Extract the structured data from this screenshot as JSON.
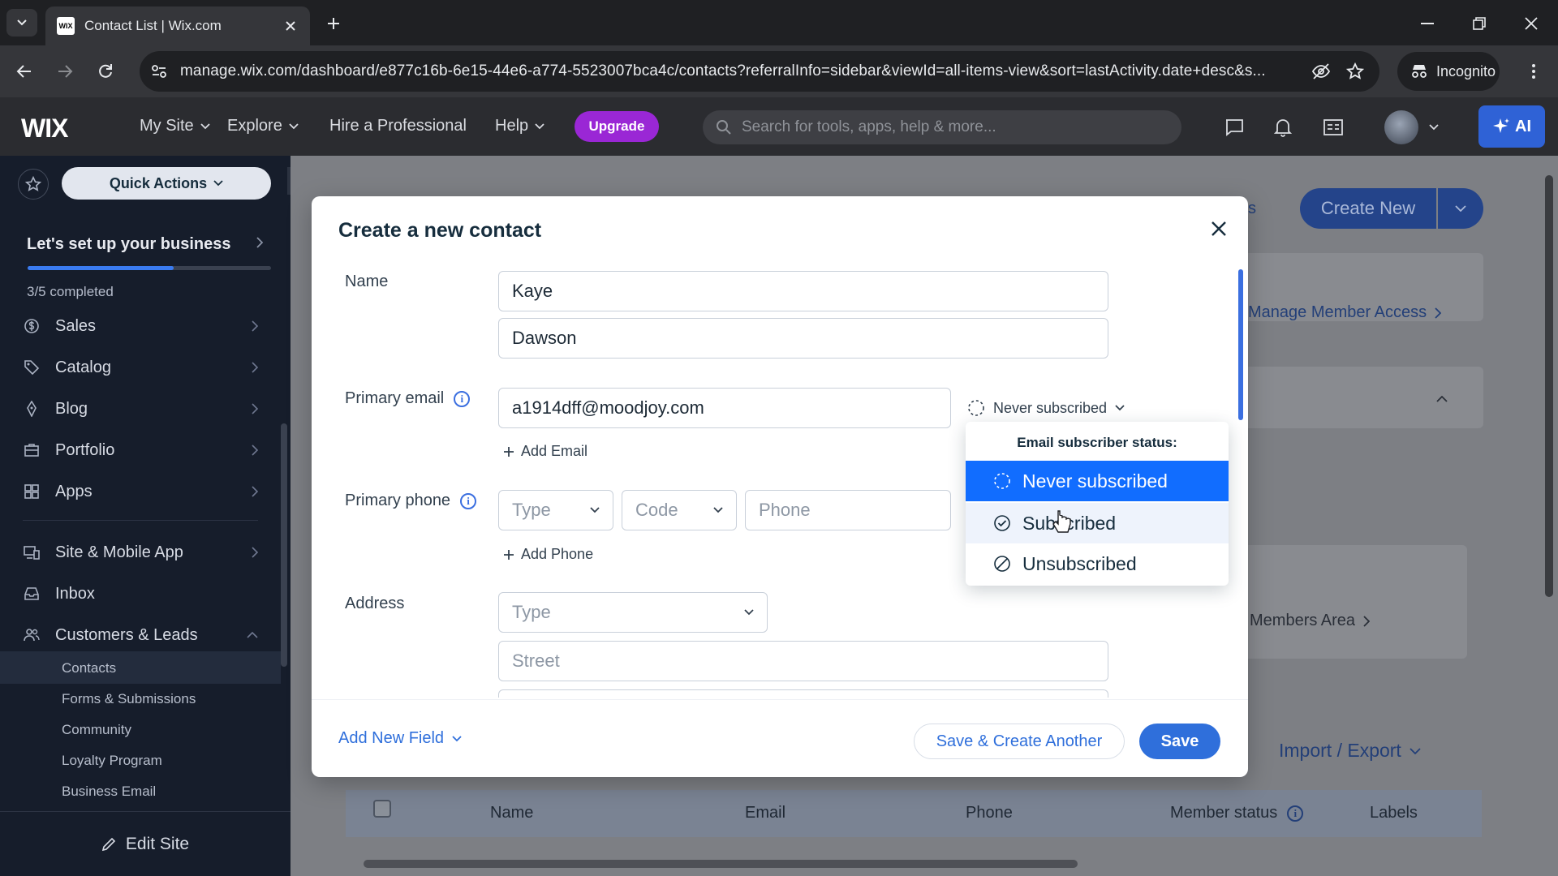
{
  "browser": {
    "tab_title": "Contact List | Wix.com",
    "favicon_text": "WIX",
    "url": "manage.wix.com/dashboard/e877c16b-6e15-44e6-a774-5523007bca4c/contacts?referralInfo=sidebar&viewId=all-items-view&sort=lastActivity.date+desc&s...",
    "incognito_label": "Incognito"
  },
  "wix_bar": {
    "logo": "WIX",
    "my_site": "My Site",
    "explore": "Explore",
    "hire": "Hire a Professional",
    "help": "Help",
    "upgrade": "Upgrade",
    "search_placeholder": "Search for tools, apps, help & more...",
    "ai_label": "AI"
  },
  "sidebar": {
    "quick_actions": "Quick Actions",
    "setup_title": "Let's set up your business",
    "setup_progress": 0.6,
    "setup_completed": "3/5 completed",
    "items": [
      {
        "label": "Sales",
        "icon": "dollar-icon"
      },
      {
        "label": "Catalog",
        "icon": "tag-icon"
      },
      {
        "label": "Blog",
        "icon": "pen-icon"
      },
      {
        "label": "Portfolio",
        "icon": "briefcase-icon"
      },
      {
        "label": "Apps",
        "icon": "apps-icon"
      },
      {
        "label": "Site & Mobile App",
        "icon": "devices-icon"
      },
      {
        "label": "Inbox",
        "icon": "inbox-icon"
      },
      {
        "label": "Customers & Leads",
        "icon": "people-icon"
      }
    ],
    "sub_items": [
      "Contacts",
      "Forms & Submissions",
      "Community",
      "Loyalty Program",
      "Business Email"
    ],
    "edit_site": "Edit Site"
  },
  "dashboard": {
    "partial_link": "s",
    "create_new": "Create New",
    "manage_member_access": "Manage Member Access",
    "members_area": "Members Area",
    "import_export": "Import / Export",
    "table_headers": {
      "name": "Name",
      "email": "Email",
      "phone": "Phone",
      "member_status": "Member status",
      "labels": "Labels"
    }
  },
  "modal": {
    "title": "Create a new contact",
    "name_label": "Name",
    "first_name": "Kaye",
    "last_name": "Dawson",
    "email_label": "Primary email",
    "email_value": "a1914dff@moodjoy.com",
    "subscriber_status": "Never subscribed",
    "add_email": "Add Email",
    "phone_label": "Primary phone",
    "phone_type_placeholder": "Type",
    "phone_code_placeholder": "Code",
    "phone_placeholder": "Phone",
    "add_phone": "Add Phone",
    "address_label": "Address",
    "address_type_placeholder": "Type",
    "street_placeholder": "Street",
    "add_new_field": "Add New Field",
    "save_and_create": "Save & Create Another",
    "save": "Save"
  },
  "dropdown": {
    "title": "Email subscriber status:",
    "options": [
      "Never subscribed",
      "Subscribed",
      "Unsubscribed"
    ],
    "selected": "Never subscribed",
    "hovered": "Subscribed"
  },
  "colors": {
    "accent": "#116dff",
    "upgrade": "#9a27d5",
    "sidebar_bg": "#161d2b"
  }
}
